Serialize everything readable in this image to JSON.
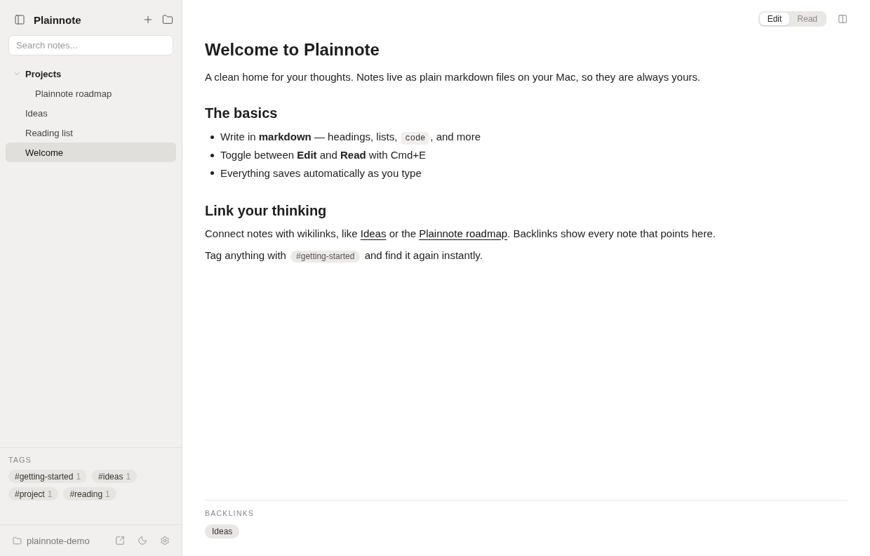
{
  "sidebar": {
    "title": "Plainnote",
    "search": {
      "placeholder": "Search notes..."
    },
    "tree": [
      {
        "label": "Projects",
        "kind": "folder",
        "expanded": true,
        "selected": false,
        "children": [
          {
            "label": "Plainnote roadmap",
            "kind": "note",
            "selected": false
          }
        ]
      },
      {
        "label": "Ideas",
        "kind": "note",
        "selected": false
      },
      {
        "label": "Reading list",
        "kind": "note",
        "selected": false
      },
      {
        "label": "Welcome",
        "kind": "note",
        "selected": true
      }
    ],
    "tags": {
      "heading": "TAGS",
      "items": [
        {
          "name": "#getting-started",
          "count": "1"
        },
        {
          "name": "#ideas",
          "count": "1"
        },
        {
          "name": "#project",
          "count": "1"
        },
        {
          "name": "#reading",
          "count": "1"
        }
      ]
    },
    "footer": {
      "vault": "plainnote-demo"
    }
  },
  "toolbar": {
    "modes": [
      {
        "label": "Edit",
        "selected": true
      },
      {
        "label": "Read",
        "selected": false
      }
    ]
  },
  "note": {
    "title": "Welcome to Plainnote",
    "blocks": [
      {
        "kind": "paragraph",
        "inline": [
          {
            "kind": "text",
            "text": "A clean home for your thoughts. Notes live as plain markdown files on your Mac, so they are always yours."
          }
        ]
      },
      {
        "kind": "heading",
        "text": "The basics"
      },
      {
        "kind": "list",
        "items": [
          {
            "inline": [
              {
                "kind": "text",
                "text": "Write in **markdown** — headings, lists, "
              },
              {
                "kind": "code",
                "text": "code"
              },
              {
                "kind": "text",
                "text": ", and more"
              }
            ]
          },
          {
            "inline": [
              {
                "kind": "text",
                "text": "Toggle between **Edit** and **Read** with Cmd+E"
              }
            ]
          },
          {
            "inline": [
              {
                "kind": "text",
                "text": "Everything saves automatically as you type"
              }
            ]
          }
        ]
      },
      {
        "kind": "heading",
        "text": "Link your thinking"
      },
      {
        "kind": "paragraph",
        "inline": [
          {
            "kind": "text",
            "text": "Connect notes with wikilinks, like "
          },
          {
            "kind": "link",
            "text": "Ideas"
          },
          {
            "kind": "text",
            "text": " or the "
          },
          {
            "kind": "link",
            "text": "Plainnote roadmap"
          },
          {
            "kind": "text",
            "text": ". Backlinks show every note that points here."
          }
        ]
      },
      {
        "kind": "paragraph",
        "inline": [
          {
            "kind": "text",
            "text": "Tag anything with "
          },
          {
            "kind": "tag",
            "text": "#getting-started"
          },
          {
            "kind": "text",
            "text": " and find it again instantly."
          }
        ]
      }
    ]
  },
  "backlinks": {
    "heading": "BACKLINKS",
    "items": [
      {
        "label": "Ideas"
      }
    ]
  }
}
